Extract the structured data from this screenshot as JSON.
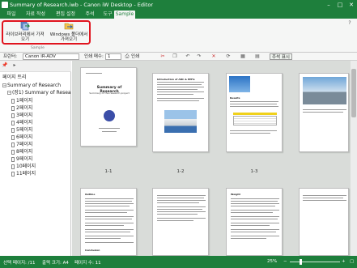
{
  "window": {
    "title": "Summary of Research.iwb - Canon iW Desktop - Editor"
  },
  "tabs": [
    "파일",
    "자료 작성",
    "편집 설정",
    "주석",
    "도구",
    "Sample"
  ],
  "active_tab": "Sample",
  "ribbon": {
    "btn_library": "라이브러리에서 가져오기",
    "btn_windows": "Windows 폴더에서 가져오기",
    "group_label": "Sample"
  },
  "printrow": {
    "printer_label": "프린터:",
    "printer_value": "Canon iR-ADV",
    "copies_label": "인쇄 매수:",
    "copies_value": "1",
    "print_label": "인쇄",
    "annot_label": "주석 표시"
  },
  "leftpane": {
    "title": "페이지 트리",
    "root": "Summary of Research",
    "sub": "(장1) Summary of Resea",
    "pages": [
      "1페이지",
      "2페이지",
      "3페이지",
      "4페이지",
      "5페이지",
      "6페이지",
      "7페이지",
      "8페이지",
      "9페이지",
      "10페이지",
      "11페이지"
    ]
  },
  "thumbs": {
    "labels": [
      "1-1",
      "1-2",
      "1-3"
    ],
    "p1_title": "Summary of Research",
    "p1_sub": "Summary of the research project",
    "p2_title": "Introduction of ABC & EEFG",
    "p3_title": "Results",
    "p4_title": "Outline",
    "p6_title": "Weight",
    "p5_head": "Conclusion"
  },
  "status": {
    "selected": "선택 페이지: /11",
    "paper": "출력 크기: A4",
    "pagecount": "페이지 수: 11",
    "zoom": "25%"
  },
  "colors": {
    "accent": "#1e7f3c",
    "highlight": "#e0141e"
  }
}
